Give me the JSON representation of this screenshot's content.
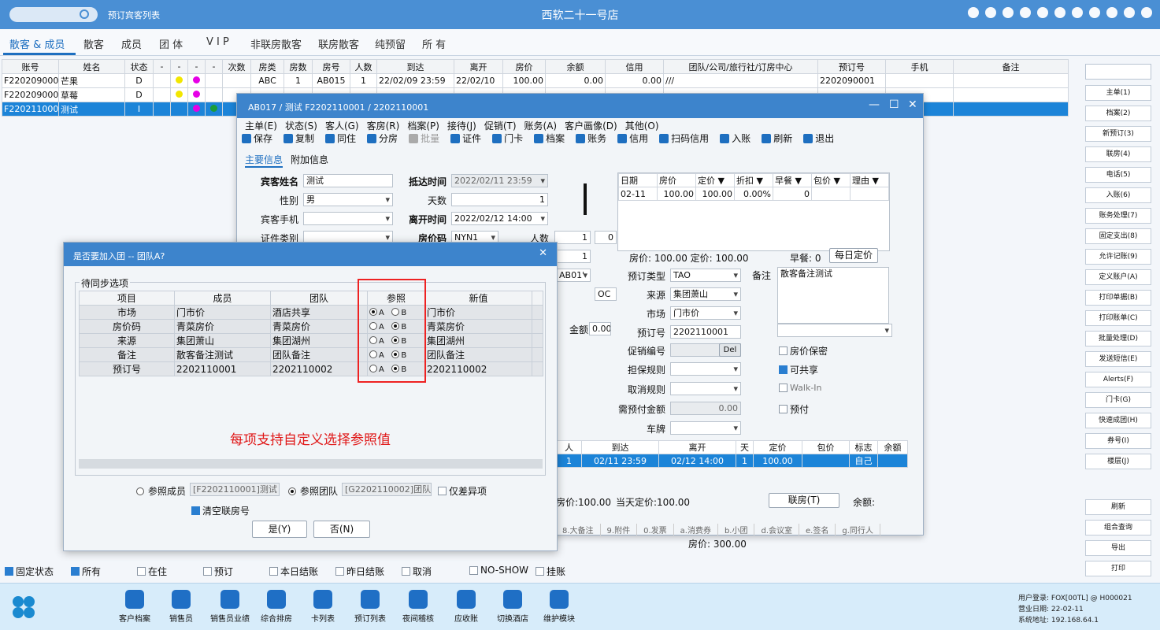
{
  "topbar": {
    "link": "预订宾客列表",
    "title": "西软二十一号店"
  },
  "tabs": [
    "散客 & 成员",
    "散客",
    "成员",
    "团 体",
    "V I P",
    "非联房散客",
    "联房散客",
    "纯预留",
    "所 有"
  ],
  "grid": {
    "headers": [
      "账号",
      "姓名",
      "状态",
      "-",
      "-",
      "-",
      "-",
      "次数",
      "房类",
      "房数",
      "房号",
      "人数",
      "到达",
      "离开",
      "房价",
      "余额",
      "信用",
      "团队/公司/旅行社/订房中心",
      "预订号",
      "手机",
      "备注"
    ],
    "rows": [
      {
        "acct": "F2202090001",
        "name": "芒果",
        "status": "D",
        "c1": "#f2e600",
        "c2": "#e600e6",
        "type": "ABC",
        "rooms": "1",
        "room": "AB015",
        "ppl": "1",
        "arr": "22/02/09 23:59",
        "dep": "22/02/10",
        "rate": "100.00",
        "bal": "0.00",
        "credit": "0.00",
        "org": "///",
        "resv": "2202090001"
      },
      {
        "acct": "F2202090002",
        "name": "草莓",
        "status": "D",
        "c1": "#f2e600",
        "c2": "#e600e6",
        "type": "",
        "rooms": "",
        "room": "",
        "ppl": "",
        "arr": "",
        "dep": "",
        "rate": "",
        "bal": "",
        "credit": "",
        "org": "",
        "resv": ""
      },
      {
        "acct": "F2202110001",
        "name": "测试",
        "status": "I",
        "c1": "",
        "c2": "#e600e6",
        "type": "",
        "rooms": "",
        "room": "",
        "ppl": "",
        "arr": "",
        "dep": "",
        "rate": "",
        "bal": "",
        "credit": "",
        "org": "",
        "resv": ""
      }
    ]
  },
  "right_panel": [
    "主单(1)",
    "档案(2)",
    "新预订(3)",
    "联房(4)",
    "电话(5)",
    "入账(6)",
    "账务处理(7)",
    "固定支出(8)",
    "允许记账(9)",
    "定义账户(A)",
    "打印单据(B)",
    "打印账单(C)",
    "批量处理(D)",
    "发送短信(E)",
    "Alerts(F)",
    "门卡(G)",
    "快速成团(H)",
    "券号(I)",
    "楼层(J)",
    "刷新",
    "组合查询",
    "导出",
    "打印"
  ],
  "filters": [
    {
      "label": "固定状态",
      "on": true
    },
    {
      "label": "所有",
      "on": true
    },
    {
      "label": "在住",
      "on": false
    },
    {
      "label": "预订",
      "on": false
    },
    {
      "label": "本日结账",
      "on": false
    },
    {
      "label": "昨日结账",
      "on": false
    },
    {
      "label": "取消",
      "on": false
    },
    {
      "label": "NO-SHOW",
      "on": false
    },
    {
      "label": "挂账",
      "on": false
    }
  ],
  "bottom_icons": [
    "客户档案",
    "销售员",
    "销售员业绩",
    "综合排房",
    "卡列表",
    "预订列表",
    "夜间稽核",
    "应收账",
    "切换酒店",
    "维护模块"
  ],
  "login": {
    "user": "用户登录: FOX[00TL] @ H000021",
    "date": "营业日期: 22-02-11",
    "ip": "系统地址: 192.168.64.1"
  },
  "room_dialog": {
    "title": "AB017 / 测试 F2202110001 / 2202110001",
    "menu": [
      "主单(E)",
      "状态(S)",
      "客人(G)",
      "客房(R)",
      "档案(P)",
      "接待(J)",
      "促销(T)",
      "账务(A)",
      "客户画像(D)",
      "其他(O)"
    ],
    "toolbar": [
      "保存",
      "复制",
      "同住",
      "分房",
      "批量",
      "证件",
      "门卡",
      "档案",
      "账务",
      "信用",
      "扫码信用",
      "入账",
      "刷新",
      "退出"
    ],
    "tabs": [
      "主要信息",
      "附加信息"
    ],
    "name_label": "宾客姓名",
    "name": "测试",
    "gender_label": "性别",
    "gender": "男",
    "phone_label": "宾客手机",
    "idtype_label": "证件类别",
    "arrive_label": "抵达时间",
    "arrive": "2022/02/11 23:59",
    "days_label": "天数",
    "days": "1",
    "depart_label": "离开时间",
    "depart": "2022/02/12 14:00",
    "ratecode_label": "房价码",
    "ratecode": "NYN1",
    "people_label": "人数",
    "people": "1",
    "people2": "0",
    "one": "1",
    "ab01": "AB01'",
    "oc": "OC",
    "amount_label": "金额",
    "amount": "0.00",
    "rate_headers": [
      "日期",
      "房价",
      "定价 ▼",
      "折扣 ▼",
      "早餐 ▼",
      "包价 ▼",
      "理由 ▼"
    ],
    "rate_row": [
      "02-11",
      "100.00",
      "100.00",
      "0.00%",
      "0",
      "",
      ""
    ],
    "rate_summary": "房价: 100.00   定价: 100.00",
    "breakfast": "早餐: 0",
    "daily_btn": "每日定价",
    "resvtype_label": "预订类型",
    "resvtype": "TAO",
    "source_label": "来源",
    "source": "集团萧山",
    "market_label": "市场",
    "market": "门市价",
    "resvno_label": "预订号",
    "resvno": "2202110001",
    "promo_label": "促销编号",
    "del": "Del",
    "guar_label": "担保规则",
    "cancel_label": "取消规则",
    "deposit_label": "需预付金额",
    "deposit": "0.00",
    "plate_label": "车牌",
    "remark_label": "备注",
    "remark": "散客备注测试",
    "chk_secret": "房价保密",
    "chk_share": "可共享",
    "chk_walkin": "Walk-In",
    "chk_prepay": "预付",
    "sum_headers": [
      "人",
      "到达",
      "离开",
      "天",
      "定价",
      "包价",
      "标志",
      "余额"
    ],
    "sum_row": [
      "1",
      "02/11 23:59",
      "02/12 14:00",
      "1",
      "100.00",
      "",
      "自己",
      ""
    ],
    "price_text": "房价:100.00",
    "cur_text": "当天定价:100.00",
    "joint_btn": "联房(T)",
    "balance_text": "余额:",
    "bottom_tabs": [
      "8.大备注",
      "9.附件",
      "0.发票",
      "a.消费券",
      "b.小团",
      "d.会议室",
      "e.签名",
      "g.同行人"
    ],
    "total": "房价: 300.00"
  },
  "group_dialog": {
    "title": "是否要加入团 -- 团队A?",
    "legend": "待同步选项",
    "headers": [
      "项目",
      "成员",
      "团队",
      "参照",
      "新值"
    ],
    "rows": [
      {
        "item": "市场",
        "member": "门市价",
        "group": "酒店共享",
        "ref": "A",
        "new": "门市价"
      },
      {
        "item": "房价码",
        "member": "青菜房价",
        "group": "青菜房价",
        "ref": "B",
        "new": "青菜房价"
      },
      {
        "item": "来源",
        "member": "集团萧山",
        "group": "集团湖州",
        "ref": "B",
        "new": "集团湖州"
      },
      {
        "item": "备注",
        "member": "散客备注测试",
        "group": "团队备注",
        "ref": "B",
        "new": "团队备注"
      },
      {
        "item": "预订号",
        "member": "2202110001",
        "group": "2202110002",
        "ref": "B",
        "new": "2202110002"
      }
    ],
    "annotation": "每项支持自定义选择参照值",
    "ref_member": "参照成员",
    "ref_member_val": "[F2202110001]测试",
    "ref_group": "参照团队",
    "ref_group_val": "[G2202110002]团队A",
    "diff_only": "仅差异项",
    "clear_joint": "清空联房号",
    "yes": "是(Y)",
    "no": "否(N)"
  }
}
